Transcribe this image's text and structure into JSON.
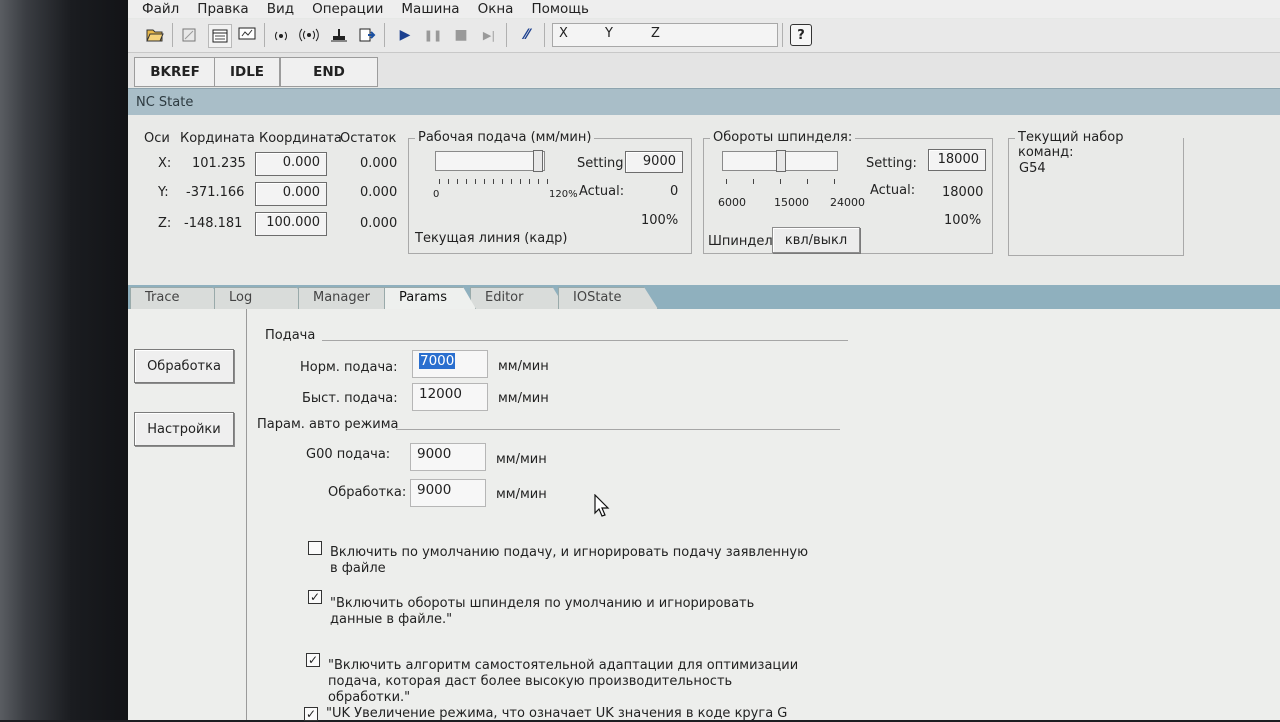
{
  "menu": [
    "Файл",
    "Правка",
    "Вид",
    "Операции",
    "Машина",
    "Окна",
    "Помощь"
  ],
  "toolbar": {
    "icons": [
      "open-folder-icon",
      "edit-icon",
      "window-icon",
      "screen-icon",
      "signal-icon",
      "signal2-icon",
      "home-icon",
      "load-icon",
      "run-icon",
      "pause-icon",
      "stop-icon",
      "step-icon",
      "slash-icon"
    ],
    "run": "▶",
    "pause": "❚❚",
    "stop": "■",
    "step": "▶|",
    "slash": "⁄⁄",
    "coord_x": "X",
    "coord_y": "Y",
    "coord_z": "Z",
    "help": "?"
  },
  "status": {
    "btn1": "BKREF",
    "btn2": "IDLE",
    "btn3": "END"
  },
  "nc_state_title": "NC State",
  "axes": {
    "headers": {
      "axis": "Оси",
      "coord": "Кордината",
      "coord2": "Координата",
      "rest": "Остаток"
    },
    "rows": [
      {
        "axis": "X:",
        "coord": "101.235",
        "coord2": "0.000",
        "rest": "0.000"
      },
      {
        "axis": "Y:",
        "coord": "-371.166",
        "coord2": "0.000",
        "rest": "0.000"
      },
      {
        "axis": "Z:",
        "coord": "-148.181",
        "coord2": "100.000",
        "rest": "0.000"
      }
    ]
  },
  "feed": {
    "title": "Рабочая подача (мм/мин)",
    "setting_label": "Setting:",
    "setting": "9000",
    "actual_label": "Actual:",
    "actual": "0",
    "percent": "100%",
    "min": "0",
    "max": "120%",
    "current_line": "Текущая линия (кадр)"
  },
  "spindle": {
    "title": "Обороты шпинделя:",
    "setting_label": "Setting:",
    "setting": "18000",
    "actual_label": "Actual:",
    "actual": "18000",
    "percent": "100%",
    "scale": [
      "6000",
      "15000",
      "24000"
    ],
    "spindle_label": "Шпиндел",
    "toggle": "квл/выкл"
  },
  "commands": {
    "title": "Текущий набор команд:",
    "value": "G54"
  },
  "tabs": [
    "Trace",
    "Log",
    "Manager",
    "Params",
    "Editor",
    "IOState"
  ],
  "active_tab": "Params",
  "nav": {
    "btn1": "Обработка",
    "btn2": "Настройки"
  },
  "params": {
    "section1": "Подача",
    "norm_label": "Норм. подача:",
    "norm_value": "7000",
    "norm_unit": "мм/мин",
    "fast_label": "Быст. подача:",
    "fast_value": "12000",
    "fast_unit": "мм/мин",
    "section2": "Парам. авто режима",
    "g00_label": "G00 подача:",
    "g00_value": "9000",
    "g00_unit": "мм/мин",
    "proc_label": "Обработка:",
    "proc_value": "9000",
    "proc_unit": "мм/мин"
  },
  "checkboxes": [
    {
      "checked": false,
      "label": "Включить по умолчанию подачу, и игнорировать подачу заявленную в файле"
    },
    {
      "checked": true,
      "label": "\"Включить обороты шпинделя по умолчанию и игнорировать данные в файле.\""
    },
    {
      "checked": true,
      "label": "\"Включить алгоритм самостоятельной адаптации для оптимизации подача, которая даст более высокую производительность обработки.\""
    },
    {
      "checked": true,
      "label": "\"UK Увеличение режима, что означает UK значения в коде круга G"
    }
  ],
  "check_mark": "✓"
}
